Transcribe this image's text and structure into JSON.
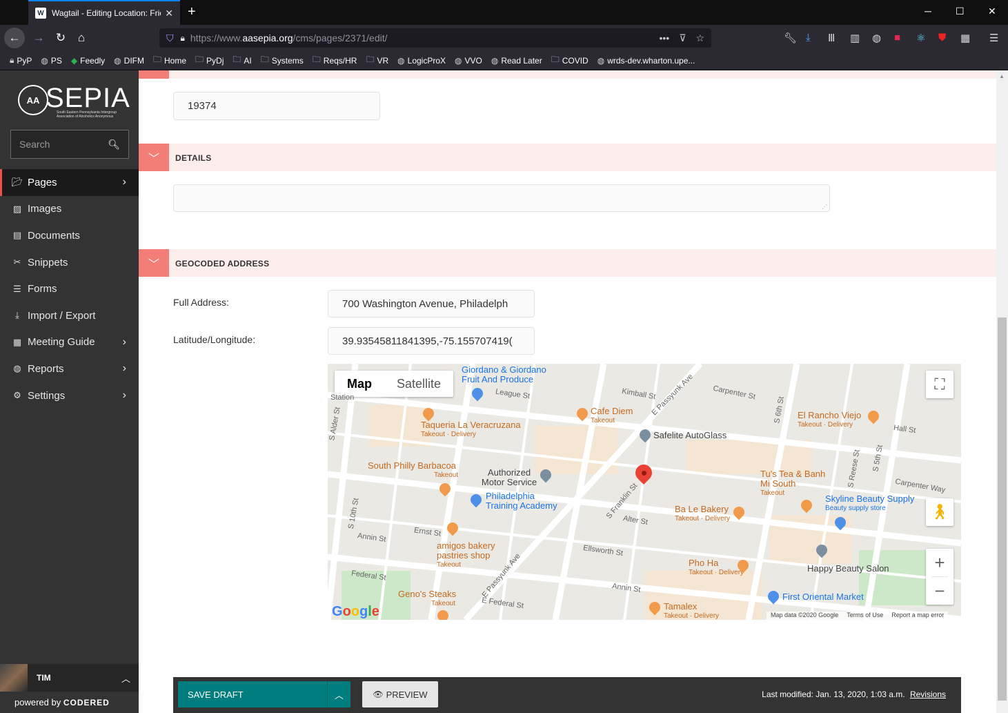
{
  "browser": {
    "tab_title": "Wagtail - Editing Location: Frie",
    "url_prefix": "https://www.",
    "url_domain": "aasepia.org",
    "url_path": "/cms/pages/2371/edit/",
    "bookmarks": [
      "PyP",
      "PS",
      "Feedly",
      "DIFM",
      "Home",
      "PyDj",
      "AI",
      "Systems",
      "Reqs/HR",
      "VR",
      "LogicProX",
      "VVO",
      "Read Later",
      "COVID",
      "wrds-dev.wharton.upe..."
    ]
  },
  "sidebar": {
    "brand": "SEPIA",
    "logo_mark": "AA",
    "tagline": "South Eastern Pennsylvania Intergroup Association of Alcoholics Anonymous",
    "search_placeholder": "Search",
    "items": [
      {
        "label": "Pages",
        "icon": "folder-open-icon"
      },
      {
        "label": "Images",
        "icon": "image-icon"
      },
      {
        "label": "Documents",
        "icon": "document-icon"
      },
      {
        "label": "Snippets",
        "icon": "snippet-icon"
      },
      {
        "label": "Forms",
        "icon": "form-icon"
      },
      {
        "label": "Import / Export",
        "icon": "download-icon"
      },
      {
        "label": "Meeting Guide",
        "icon": "grid-icon"
      },
      {
        "label": "Reports",
        "icon": "globe-icon"
      },
      {
        "label": "Settings",
        "icon": "cogs-icon"
      }
    ],
    "account_name": "TIM",
    "powered_by": "powered by",
    "powered_brand": "CODERED"
  },
  "form": {
    "zip_value": "19374",
    "details_label": "DETAILS",
    "geocoded_label": "GEOCODED ADDRESS",
    "full_address_label": "Full Address:",
    "full_address_value": "700 Washington Avenue, Philadelph",
    "latlng_label": "Latitude/Longitude:",
    "latlng_value": "39.93545811841395,-75.155707419("
  },
  "map": {
    "type_map": "Map",
    "type_satellite": "Satellite",
    "google": "Google",
    "footer_data": "Map data ©2020 Google",
    "footer_terms": "Terms of Use",
    "footer_report": "Report a map error",
    "places": {
      "giordano": "Giordano & Giordano Fruit And Produce",
      "taqueria": "Taqueria La Veracruzana",
      "taqueria_sub": "Takeout · Delivery",
      "cafe_diem": "Cafe Diem",
      "cafe_diem_sub": "Takeout",
      "safelite": "Safelite AutoGlass",
      "el_rancho": "El Rancho Viejo",
      "el_rancho_sub": "Takeout · Delivery",
      "south_philly": "South Philly Barbacoa",
      "south_philly_sub": "Takeout",
      "authorized": "Authorized Motor Service",
      "training": "Philadelphia Training Academy",
      "tus_tea": "Tu's Tea & Banh Mi South",
      "tus_tea_sub": "Takeout",
      "skyline": "Skyline Beauty Supply",
      "skyline_sub": "Beauty supply store",
      "ba_le": "Ba Le Bakery",
      "ba_le_sub": "Takeout · Delivery",
      "amigos": "amigos bakery pastries shop",
      "amigos_sub": "Takeout",
      "pho_ha": "Pho Ha",
      "pho_ha_sub": "Takeout · Delivery",
      "happy": "Happy Beauty Salon",
      "genos": "Geno's Steaks",
      "genos_sub": "Takeout",
      "first_oriental": "First Oriental Market",
      "tamalex": "Tamalex",
      "tamalex_sub": "Takeout · Delivery"
    },
    "streets": {
      "league_st": "League St",
      "kimball_st": "Kimball St",
      "carpenter_st": "Carpenter St",
      "e_passyunk": "E Passyunk Ave",
      "s_6th": "S 6th St",
      "hall_st": "Hall St",
      "s_5th": "S 5th St",
      "carpenter_way": "Carpenter Way",
      "s_10th": "S 10th St",
      "annin_st": "Annin St",
      "ernst_st": "Ernst St",
      "s_franklin": "S Franklin St",
      "alter_st": "Alter St",
      "ellsworth": "Ellsworth St",
      "federal_st": "Federal St",
      "e_passyunk2": "E Passyunk Ave",
      "annin_st2": "Annin St",
      "e_federal": "E Federal St",
      "s_reese": "S Reese St",
      "station": "Station",
      "s_alder": "S Alder St"
    }
  },
  "actions": {
    "save_draft": "SAVE DRAFT",
    "preview": "PREVIEW",
    "last_modified": "Last modified: Jan. 13, 2020, 1:03 a.m.",
    "revisions": "Revisions"
  }
}
